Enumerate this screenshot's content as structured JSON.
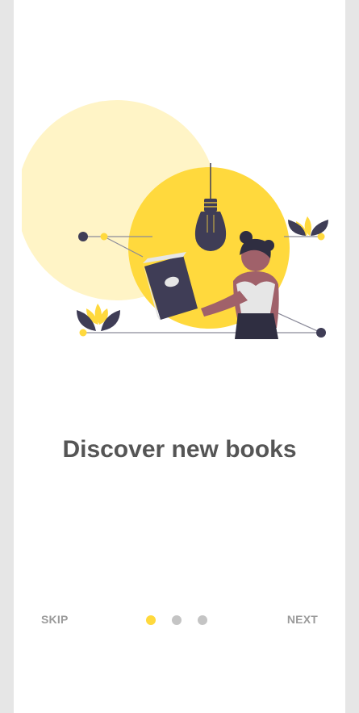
{
  "onboarding": {
    "title": "Discover new books",
    "skip_label": "SKIP",
    "next_label": "NEXT",
    "page_indicator": {
      "total": 3,
      "active_index": 0
    },
    "illustration": "woman-reading-book-illustration"
  },
  "colors": {
    "accent": "#ffd93d",
    "accent_light": "#fff4c6",
    "dark": "#3f3d56",
    "title_text": "#555555",
    "inactive_dot": "#c4c4c4",
    "frame": "#e6e6e6"
  }
}
